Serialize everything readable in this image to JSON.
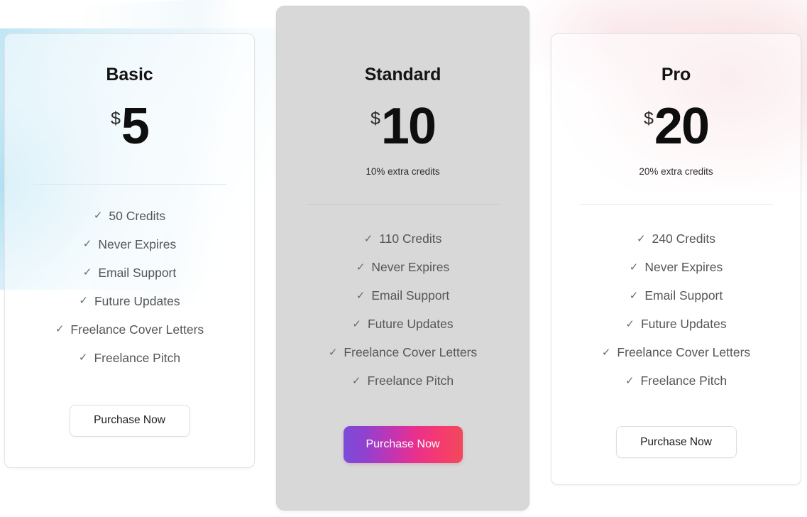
{
  "theme": {
    "gradient_button_from": "#7b4cd8",
    "gradient_button_mid": "#e0359f",
    "gradient_button_to": "#f2495c",
    "featured_card_bg": "#d8d8d8",
    "glow_blue": "#a8dcf0",
    "glow_pink": "#f6d6db"
  },
  "plans": [
    {
      "id": "basic",
      "name": "Basic",
      "currency": "$",
      "amount": "5",
      "extra_credits": "",
      "features": [
        "50 Credits",
        "Never Expires",
        "Email Support",
        "Future Updates",
        "Freelance Cover Letters",
        "Freelance Pitch"
      ],
      "cta_label": "Purchase Now",
      "cta_style": "outline",
      "featured": false
    },
    {
      "id": "standard",
      "name": "Standard",
      "currency": "$",
      "amount": "10",
      "extra_credits": "10% extra credits",
      "features": [
        "110 Credits",
        "Never Expires",
        "Email Support",
        "Future Updates",
        "Freelance Cover Letters",
        "Freelance Pitch"
      ],
      "cta_label": "Purchase Now",
      "cta_style": "gradient",
      "featured": true
    },
    {
      "id": "pro",
      "name": "Pro",
      "currency": "$",
      "amount": "20",
      "extra_credits": "20% extra credits",
      "features": [
        "240 Credits",
        "Never Expires",
        "Email Support",
        "Future Updates",
        "Freelance Cover Letters",
        "Freelance Pitch"
      ],
      "cta_label": "Purchase Now",
      "cta_style": "outline",
      "featured": false
    }
  ],
  "icons": {
    "check": "✓"
  }
}
